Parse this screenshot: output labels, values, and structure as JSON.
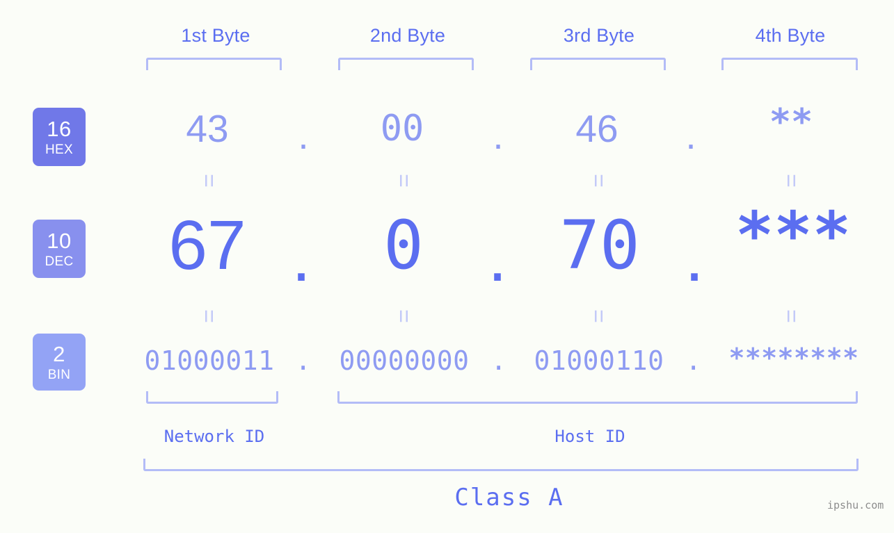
{
  "theme": {
    "background": "#fbfdf8",
    "accent_strong": "#5b6ef0",
    "accent_light": "#8e9bf2",
    "bracket": "#b3bcf7",
    "equals": "#c3caf8",
    "watermark": "#8d8d8d"
  },
  "header": {
    "bytes": [
      {
        "label": "1st Byte"
      },
      {
        "label": "2nd Byte"
      },
      {
        "label": "3rd Byte"
      },
      {
        "label": "4th Byte"
      }
    ]
  },
  "bases": [
    {
      "num": "16",
      "name": "HEX",
      "color": "#7078e8"
    },
    {
      "num": "10",
      "name": "DEC",
      "color": "#8890ee"
    },
    {
      "num": "2",
      "name": "BIN",
      "color": "#93a3f5"
    }
  ],
  "rows": {
    "hex": {
      "base_num": "16",
      "base_name": "HEX",
      "values": [
        "43",
        "00",
        "46",
        "**"
      ],
      "separators": [
        ".",
        ".",
        "."
      ]
    },
    "dec": {
      "base_num": "10",
      "base_name": "DEC",
      "values": [
        "67",
        "0",
        "70",
        "***"
      ],
      "separators": [
        ".",
        ".",
        "."
      ]
    },
    "bin": {
      "base_num": "2",
      "base_name": "BIN",
      "values": [
        "01000011",
        "00000000",
        "01000110",
        "********"
      ],
      "separators": [
        ".",
        ".",
        "."
      ]
    }
  },
  "equals_glyph": "=",
  "footer": {
    "network_id_label": "Network ID",
    "host_id_label": "Host ID",
    "class_label": "Class A",
    "watermark": "ipshu.com"
  }
}
